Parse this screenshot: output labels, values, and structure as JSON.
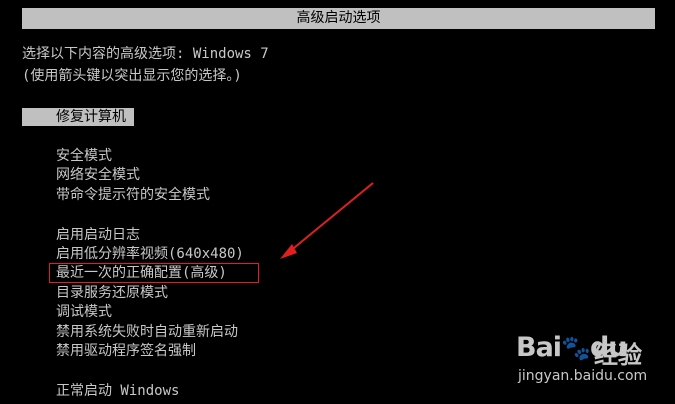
{
  "title": "高级启动选项",
  "prompt": {
    "line1": "选择以下内容的高级选项: Windows 7",
    "line2": "(使用箭头键以突出显示您的选择。)"
  },
  "selected_option": "修复计算机",
  "options_group1": [
    "安全模式",
    "网络安全模式",
    "带命令提示符的安全模式"
  ],
  "options_group2": [
    "启用启动日志",
    "启用低分辨率视频(640x480)",
    "最近一次的正确配置(高级)",
    "目录服务还原模式",
    "调试模式",
    "禁用系统失败时自动重新启动",
    "禁用驱动程序签名强制"
  ],
  "options_group3": [
    "正常启动 Windows"
  ],
  "annotation": {
    "highlighted_option": "最近一次的正确配置(高级)",
    "color": "#e02020"
  },
  "watermark": {
    "logo_text": "Bai",
    "logo_suffix": "du",
    "brand": "经验",
    "url": "jingyan.baidu.com"
  },
  "colors": {
    "background": "#000000",
    "text": "#c8c8c8",
    "bar": "#c0c0c0"
  }
}
